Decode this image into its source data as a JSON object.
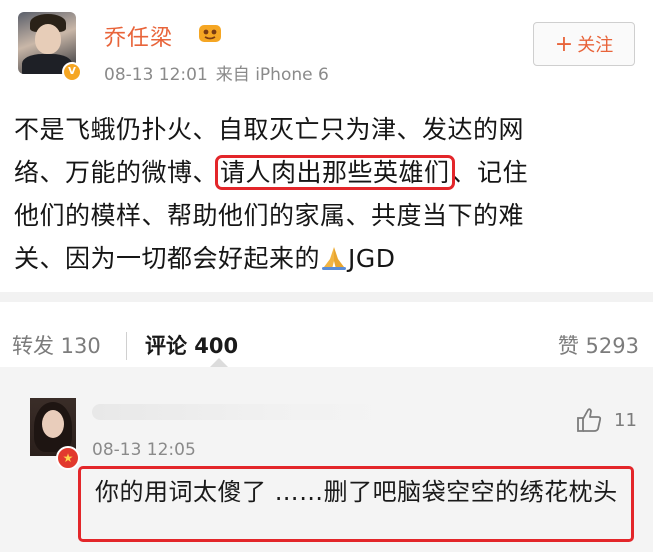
{
  "post": {
    "username": "乔任梁",
    "time": "08-13 12:01",
    "source": "来自 iPhone 6",
    "follow_label": "关注",
    "body": {
      "line1": "不是飞蛾仍扑火、自取灭亡只为津、发达的网",
      "line2_a": "络、万能的微博、",
      "line2_highlight": "请人肉出那些英雄们",
      "line2_b": "、记住",
      "line3": "他们的模样、帮助他们的家属、共度当下的难",
      "line4_a": "关、因为一切都会好起来的",
      "line4_b": "JGD"
    },
    "icons": [
      "vip-badge-icon",
      "crown-icon",
      "pray-icon"
    ]
  },
  "actions": {
    "repost": "转发 130",
    "comments": "评论 400",
    "likes": "赞 5293"
  },
  "comment": {
    "time": "08-13 12:05",
    "likes": "11",
    "text": "你的用词太傻了 ……删了吧脑袋空空的绣花枕头",
    "icons": [
      "star-badge-icon",
      "thumbs-up-icon"
    ]
  },
  "colors": {
    "username": "#e8643a",
    "highlight_box": "#e3262a",
    "meta_text": "#8a8a8a"
  }
}
